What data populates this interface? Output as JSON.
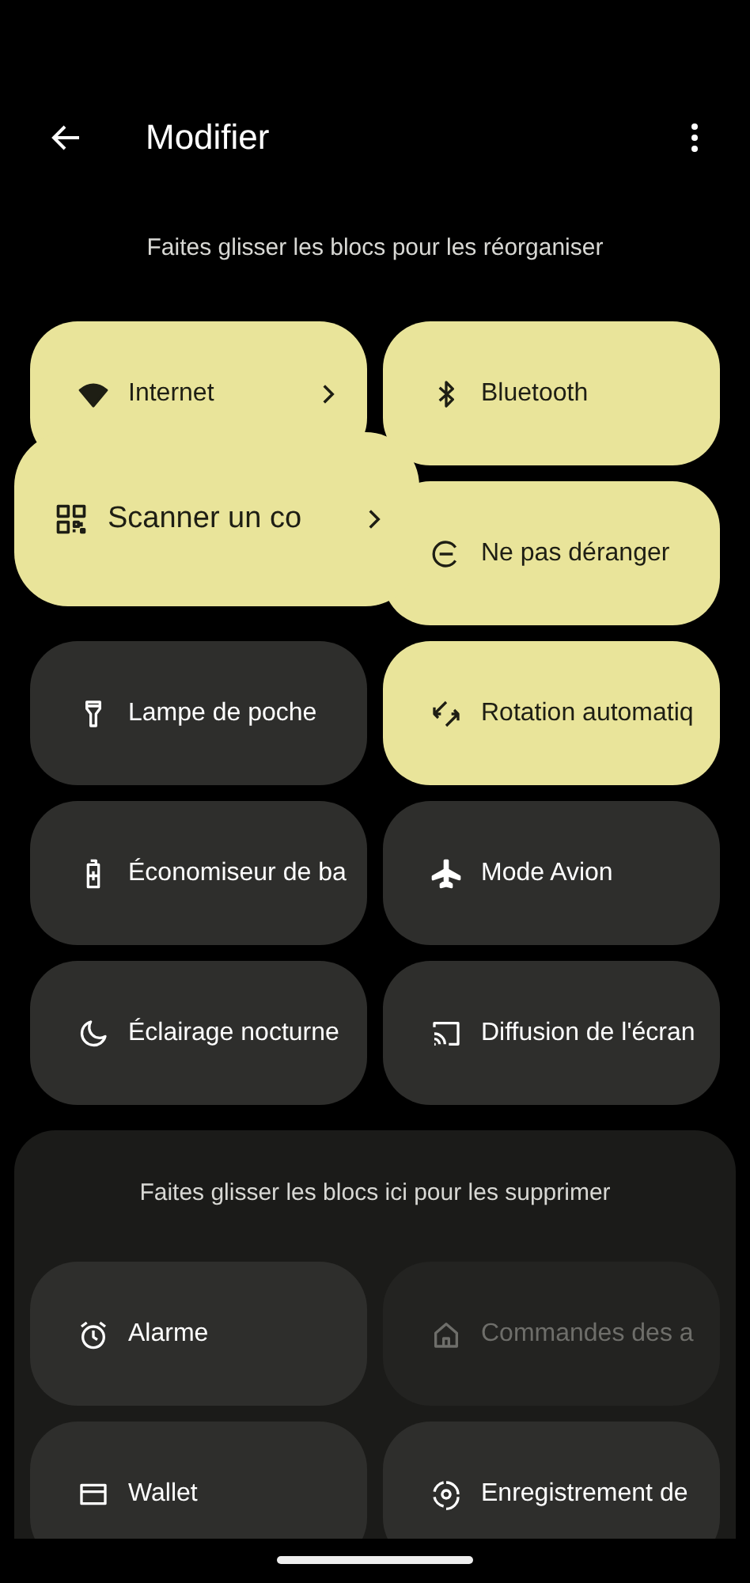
{
  "header": {
    "title": "Modifier"
  },
  "active": {
    "hint": "Faites glisser les blocs pour les réorganiser",
    "tiles": [
      {
        "label": "Internet",
        "on": true,
        "chevron": true,
        "dragging": false
      },
      {
        "label": "Bluetooth",
        "on": true,
        "chevron": false,
        "dragging": false
      },
      {
        "label": "Scanner un co",
        "on": true,
        "chevron": true,
        "dragging": true
      },
      {
        "label": "Ne pas déranger",
        "on": true,
        "chevron": false,
        "dragging": false
      },
      {
        "label": "Lampe de poche",
        "on": false,
        "chevron": false,
        "dragging": false
      },
      {
        "label": "Rotation automatiq",
        "on": true,
        "chevron": false,
        "dragging": false
      },
      {
        "label": "Économiseur de ba",
        "on": false,
        "chevron": false,
        "dragging": false
      },
      {
        "label": "Mode Avion",
        "on": false,
        "chevron": false,
        "dragging": false
      },
      {
        "label": "Éclairage nocturne",
        "on": false,
        "chevron": false,
        "dragging": false
      },
      {
        "label": "Diffusion de l'écran",
        "on": false,
        "chevron": false,
        "dragging": false
      }
    ]
  },
  "removed": {
    "hint": "Faites glisser les blocs ici pour les supprimer",
    "tiles": [
      {
        "label": "Alarme",
        "disabled": false
      },
      {
        "label": "Commandes des a",
        "disabled": true
      },
      {
        "label": "Wallet",
        "disabled": false
      },
      {
        "label": "Enregistrement de",
        "disabled": false
      }
    ]
  }
}
